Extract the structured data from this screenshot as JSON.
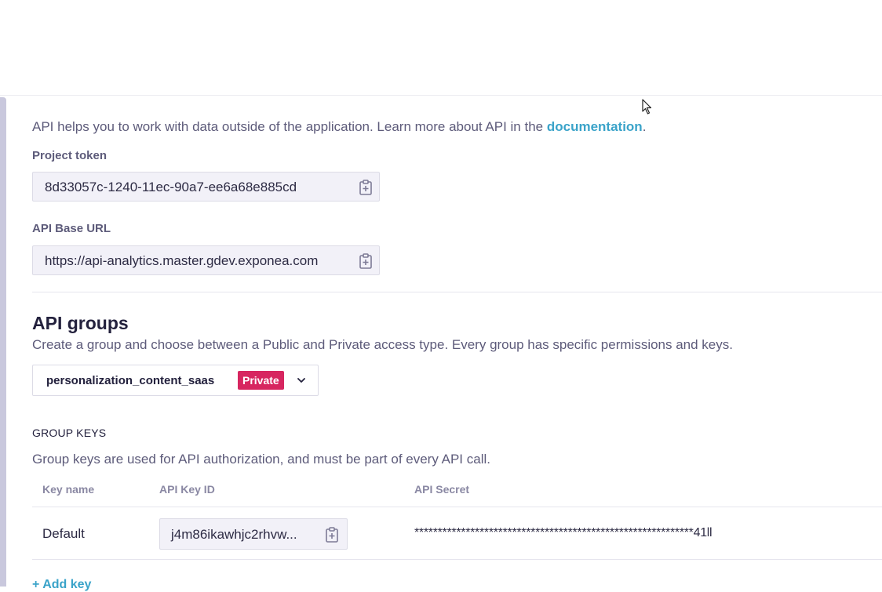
{
  "intro": {
    "text": "API helps you to work with data outside of the application. Learn more about API in the ",
    "link": "documentation",
    "end": "."
  },
  "project_token": {
    "label": "Project token",
    "value": "8d33057c-1240-11ec-90a7-ee6a68e885cd"
  },
  "api_base_url": {
    "label": "API Base URL",
    "value": "https://api-analytics.master.gdev.exponea.com"
  },
  "api_groups": {
    "title": "API groups",
    "description": "Create a group and choose between a Public and Private access type. Every group has specific permissions and keys.",
    "selected_group": "personalization_content_saas",
    "access_badge": "Private",
    "badge_color": "#d72660"
  },
  "group_keys": {
    "title": "GROUP KEYS",
    "description": "Group keys are used for API authorization, and must be part of every API call.",
    "columns": [
      "Key name",
      "API Key ID",
      "API Secret"
    ],
    "rows": [
      {
        "name": "Default",
        "key_id": "j4m86ikawhjc2rhvw...",
        "secret": "************************************************************41ll"
      }
    ],
    "add_label": "+ Add key"
  },
  "icons": {
    "copy": "clipboard-copy-icon",
    "chevron": "chevron-down-icon",
    "cursor": "mouse-pointer-icon"
  },
  "colors": {
    "link": "#3aa3c9",
    "field_bg": "#f2f1f8",
    "muted_text": "#5d5b7a"
  }
}
